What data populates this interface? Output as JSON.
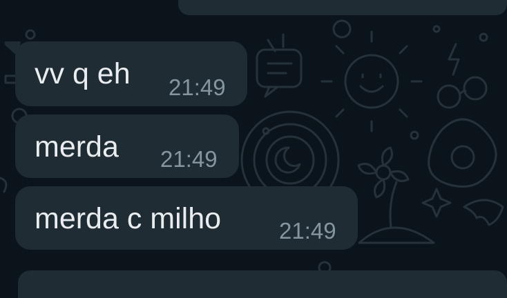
{
  "chat": {
    "background_color": "#0b141a",
    "bubble_color": "#1f2c34",
    "text_color": "#e9edef",
    "time_color": "#8696a0",
    "messages": [
      {
        "text": "vv q eh",
        "time": "21:49",
        "direction": "incoming"
      },
      {
        "text": "merda",
        "time": "21:49",
        "direction": "incoming"
      },
      {
        "text": "merda c milho",
        "time": "21:49",
        "direction": "incoming"
      }
    ]
  }
}
